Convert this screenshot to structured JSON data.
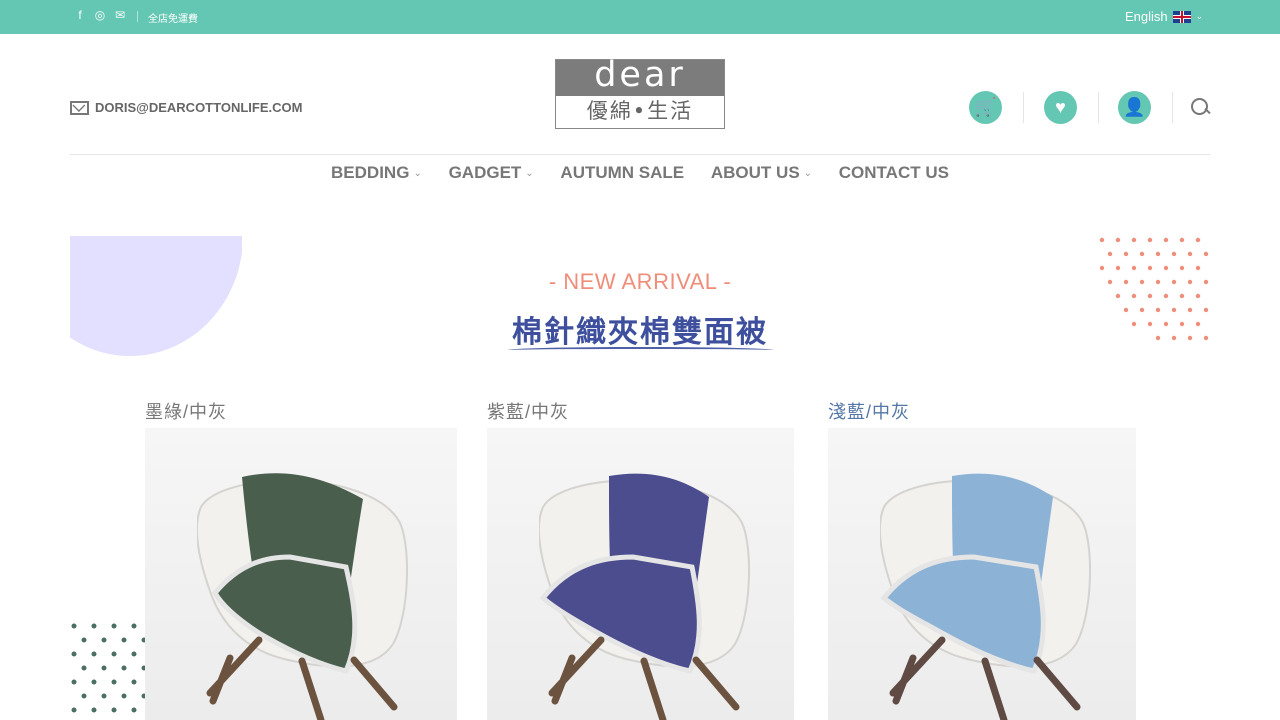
{
  "topbar": {
    "promo": "全店免運費",
    "language": "English",
    "social_icons": [
      "facebook-icon",
      "instagram-icon",
      "mail-icon"
    ]
  },
  "header": {
    "email": "DORIS@DEARCOTTONLIFE.COM",
    "logo_top": "dear",
    "logo_bottom": "優綿•生活",
    "actions": [
      "cart-icon",
      "heart-icon",
      "user-icon",
      "search-icon"
    ],
    "accent": "#64c7b3"
  },
  "nav": {
    "items": [
      {
        "label": "BEDDING",
        "dropdown": true
      },
      {
        "label": "GADGET",
        "dropdown": true
      },
      {
        "label": "AUTUMN SALE",
        "dropdown": false
      },
      {
        "label": "ABOUT US",
        "dropdown": true
      },
      {
        "label": "CONTACT US",
        "dropdown": false
      }
    ]
  },
  "hero": {
    "subtitle": "- NEW ARRIVAL -",
    "title": "棉針織夾棉雙面被",
    "subtitle_color": "#f08d7a",
    "title_color": "#3d4f9d"
  },
  "products": [
    {
      "caption": "墨綠/中灰",
      "caption_color": "#777777",
      "blanket_color": "#4a5e4e"
    },
    {
      "caption": "紫藍/中灰",
      "caption_color": "#777777",
      "blanket_color": "#4b4d8f"
    },
    {
      "caption": "淺藍/中灰",
      "caption_color": "#5577a8",
      "blanket_color": "#8cb3d6"
    }
  ]
}
